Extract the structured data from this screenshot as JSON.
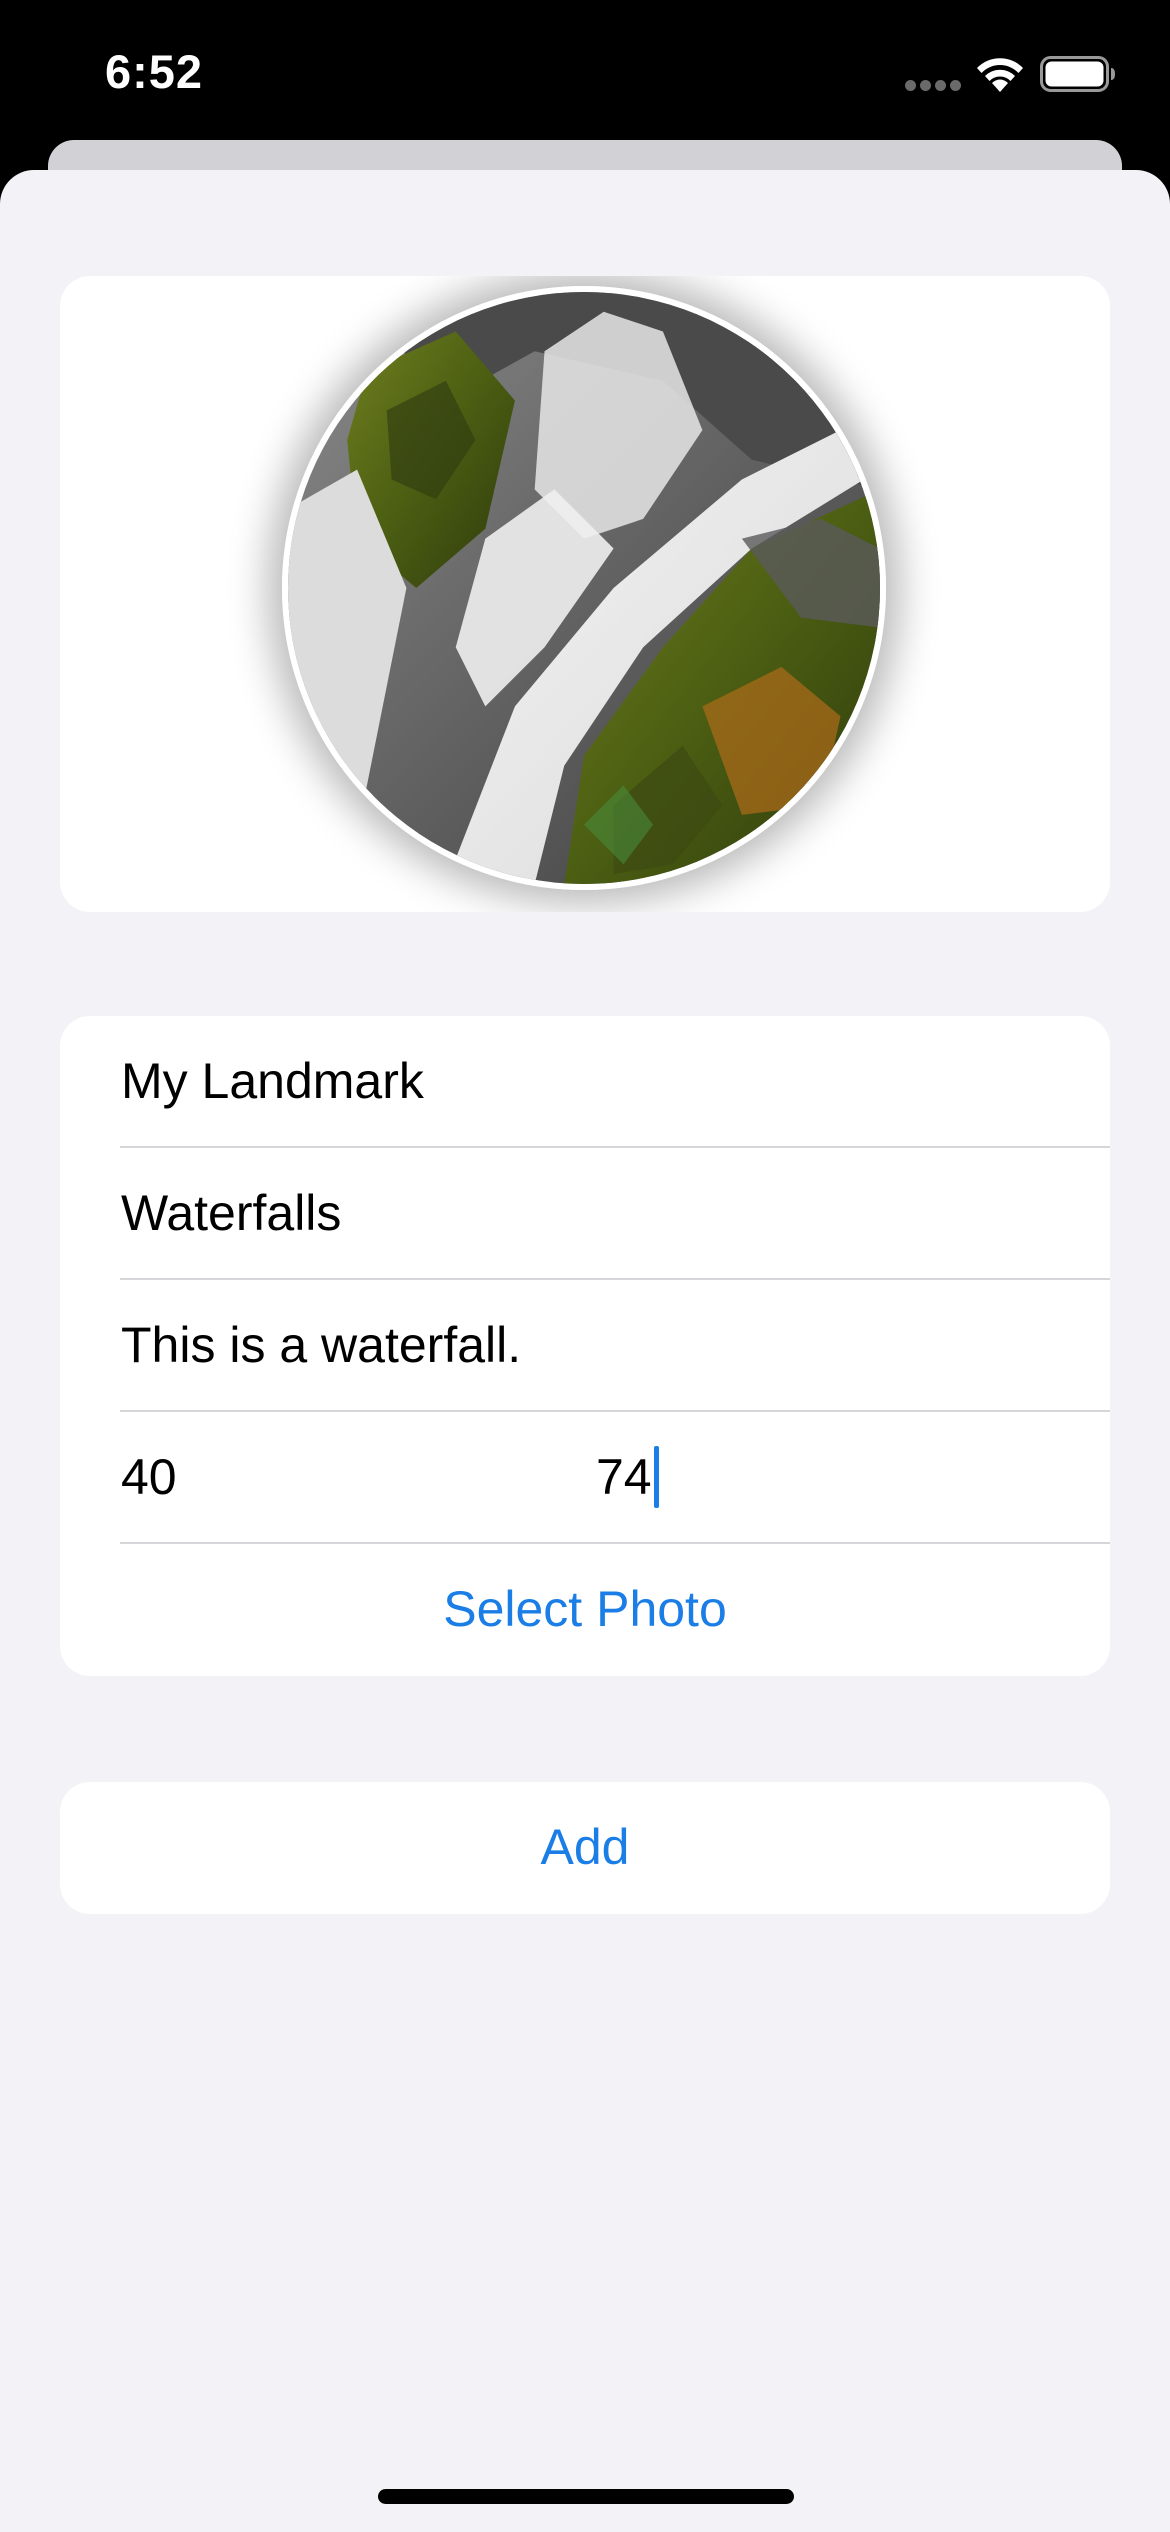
{
  "status_bar": {
    "time": "6:52",
    "icons": [
      "cellular-signal-icon",
      "wifi-icon",
      "battery-icon"
    ]
  },
  "photo": {
    "subject": "waterfall-photo"
  },
  "form": {
    "name": "My Landmark",
    "category": "Waterfalls",
    "description": "This is a waterfall.",
    "coordinate_left": "40",
    "coordinate_right": "74",
    "select_photo_label": "Select Photo"
  },
  "actions": {
    "add_label": "Add"
  },
  "colors": {
    "accent": "#1a7ee6",
    "sheet_background": "#f2f2f7",
    "card_background": "#ffffff",
    "status_bar_background": "#000000"
  }
}
